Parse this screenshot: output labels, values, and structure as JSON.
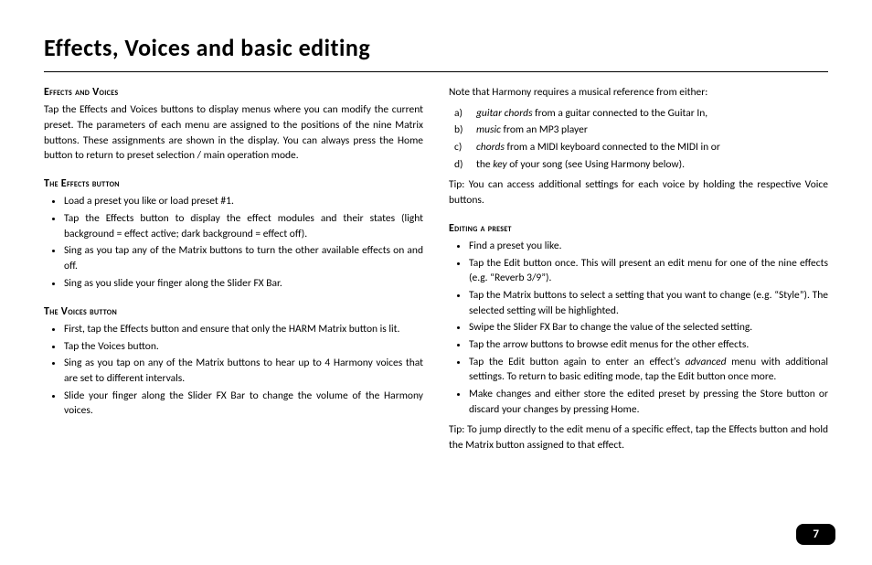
{
  "title": "Effects, Voices and basic editing",
  "page_number": "7",
  "left": {
    "effects_voices": {
      "heading": "Effects and Voices",
      "para": "Tap the Effects and Voices buttons to display menus where you can modify the current preset. The parameters of each menu are assigned to the positions of the nine Matrix buttons. These assignments are shown in the display. You can always press the Home button to return to preset selection / main operation mode."
    },
    "effects_button": {
      "heading": "The Effects button",
      "items": [
        "Load a preset you like or load preset #1.",
        "Tap the Effects button to display the effect modules and their states (light background = effect active; dark background = effect off).",
        "Sing as you tap any of the Matrix buttons to turn the other available effects on and off.",
        "Sing as you slide your finger along the Slider FX Bar."
      ]
    },
    "voices_button": {
      "heading": "The Voices button",
      "items": [
        "First, tap the Effects button and ensure that only the HARM Matrix button is lit.",
        "Tap the Voices button.",
        "Sing as you tap on any of the Matrix buttons to hear up to 4 Harmony voices that are set to different intervals.",
        "Slide your finger along the Slider FX Bar to change the volume of the Harmony voices."
      ]
    }
  },
  "right": {
    "intro": "Note that Harmony requires a musical reference from either:",
    "letters": [
      {
        "label": "a)",
        "italic": "guitar chords",
        "rest": " from a guitar connected to the Guitar In,"
      },
      {
        "label": "b)",
        "italic": "music",
        "rest": " from an MP3 player"
      },
      {
        "label": "c)",
        "italic": "chords",
        "rest": " from a MIDI keyboard connected to the MIDI in or"
      },
      {
        "label": "d)",
        "italic": "",
        "rest_pre": "the ",
        "italic2": "key",
        "rest": " of your song (see Using Harmony below)."
      }
    ],
    "tip1": "Tip: You can access additional settings for each voice by holding the respective Voice buttons.",
    "editing_preset": {
      "heading": "Editing a preset",
      "items": [
        "Find a preset you like.",
        "Tap the Edit button once. This will present an edit menu for one of the nine effects (e.g. “Reverb 3/9”).",
        "Tap the Matrix buttons to select a setting that you want to change (e.g. “Style”). The selected setting will be highlighted.",
        "Swipe the Slider FX Bar to change the value of the selected setting.",
        "Tap the arrow buttons to browse edit menus for the other effects."
      ],
      "item_adv_pre": "Tap the Edit button again to enter an effect's ",
      "item_adv_it": "advanced",
      "item_adv_post": " menu with additional settings. To return to basic editing mode, tap the Edit button once more.",
      "item_last": "Make changes and either store the edited preset by pressing the Store button or discard your changes by pressing Home."
    },
    "tip2": "Tip: To jump directly to the edit menu of a specific effect, tap the Effects button and hold the Matrix button assigned to that effect."
  }
}
